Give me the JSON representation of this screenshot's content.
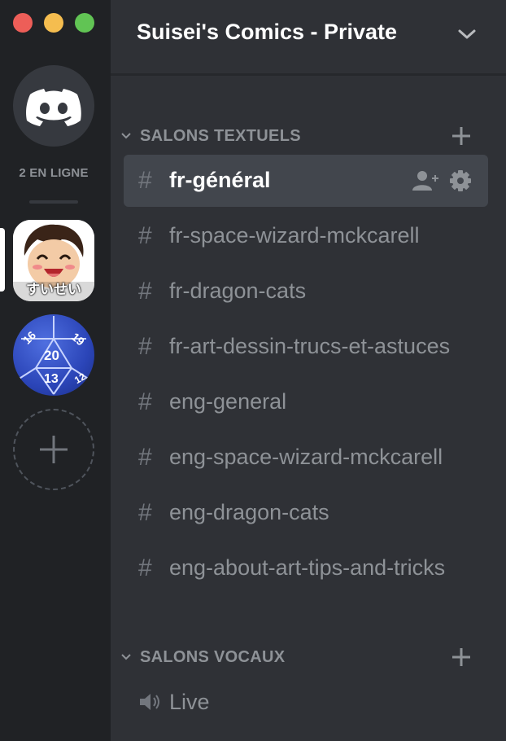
{
  "window": {
    "buttons": [
      "close",
      "minimize",
      "maximize"
    ]
  },
  "rail": {
    "home_icon": "discord-logo-icon",
    "online_count": "2 EN LIGNE",
    "servers": [
      {
        "name": "Suisei's Comics",
        "icon_caption": "すいせい",
        "selected": true
      },
      {
        "name": "d20 server",
        "icon_numbers": [
          "16",
          "20",
          "19",
          "13",
          "12"
        ],
        "selected": false
      }
    ],
    "add_server_icon": "plus-icon"
  },
  "header": {
    "server_name": "Suisei's Comics - Private",
    "dropdown_icon": "chevron-down-icon"
  },
  "text_category": {
    "label": "SALONS TEXTUELS",
    "channels": [
      {
        "name": "fr-général",
        "active": true
      },
      {
        "name": "fr-space-wizard-mckcarell"
      },
      {
        "name": "fr-dragon-cats"
      },
      {
        "name": "fr-art-dessin-trucs-et-astuces"
      },
      {
        "name": "eng-general"
      },
      {
        "name": "eng-space-wizard-mckcarell"
      },
      {
        "name": "eng-dragon-cats"
      },
      {
        "name": "eng-about-art-tips-and-tricks"
      }
    ]
  },
  "voice_category": {
    "label": "SALONS VOCAUX",
    "channels": [
      {
        "name": "Live"
      }
    ]
  },
  "colors": {
    "rail_bg": "#202225",
    "panel_bg": "#2f3136",
    "active_bg": "#42464d",
    "muted_text": "#8e9297",
    "close": "#ed5e58",
    "minimize": "#f5bd4f",
    "maximize": "#61c454"
  }
}
